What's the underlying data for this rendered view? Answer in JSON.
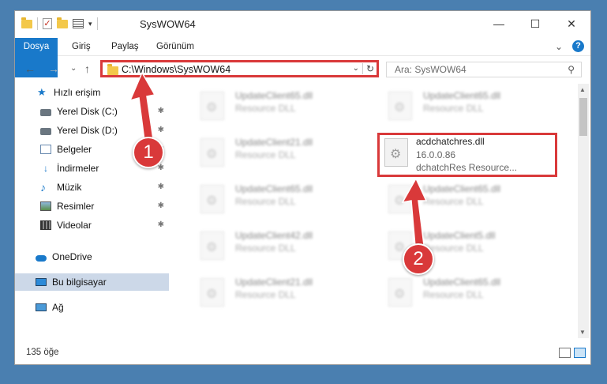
{
  "window": {
    "title": "SysWOW64",
    "controls": {
      "minimize": "—",
      "maximize": "☐",
      "close": "✕"
    }
  },
  "ribbon": {
    "tabs": [
      "Dosya",
      "Giriş",
      "Paylaş",
      "Görünüm"
    ],
    "collapse": "⌄",
    "help": "?"
  },
  "navigation": {
    "back": "←",
    "forward": "→",
    "recent": "⌄",
    "up": "↑",
    "address": "C:\\Windows\\SysWOW64",
    "address_drop": "⌄",
    "refresh": "↻",
    "search_placeholder": "Ara: SysWOW64",
    "search_icon": "⚲"
  },
  "sidebar": {
    "items": [
      {
        "label": "Hızlı erişim",
        "icon": "star-icon",
        "pinned": false
      },
      {
        "label": "Yerel Disk (C:)",
        "icon": "disk-icon",
        "pinned": true
      },
      {
        "label": "Yerel Disk (D:)",
        "icon": "disk-icon",
        "pinned": true
      },
      {
        "label": "Belgeler",
        "icon": "document-icon",
        "pinned": true
      },
      {
        "label": "İndirmeler",
        "icon": "download-icon",
        "pinned": true
      },
      {
        "label": "Müzik",
        "icon": "music-icon",
        "pinned": true
      },
      {
        "label": "Resimler",
        "icon": "pictures-icon",
        "pinned": true
      },
      {
        "label": "Videolar",
        "icon": "videos-icon",
        "pinned": true
      },
      {
        "label": "OneDrive",
        "icon": "cloud-icon",
        "pinned": false
      },
      {
        "label": "Bu bilgisayar",
        "icon": "computer-icon",
        "pinned": false,
        "selected": true
      },
      {
        "label": "Ağ",
        "icon": "network-icon",
        "pinned": false
      }
    ],
    "pin_glyph": "📌"
  },
  "files": {
    "left_column": [
      {
        "name": "UpdateClient65.dll",
        "type": "Resource DLL"
      },
      {
        "name": "UpdateClient21.dll",
        "type": "Resource DLL"
      },
      {
        "name": "UpdateClient65.dll",
        "type": "Resource DLL"
      },
      {
        "name": "UpdateClient42.dll",
        "type": "Resource DLL"
      },
      {
        "name": "UpdateClient21.dll",
        "type": "Resource DLL"
      }
    ],
    "right_column": [
      {
        "name": "UpdateClient65.dll",
        "type": "Resource DLL"
      },
      {
        "name": "UpdateClient65.dll",
        "type": "Resource DLL"
      },
      {
        "name": "UpdateClient5.dll",
        "type": "Resource DLL"
      },
      {
        "name": "UpdateClient65.dll",
        "type": "Resource DLL"
      }
    ],
    "highlighted": {
      "name": "acdchatchres.dll",
      "version": "16.0.0.86",
      "description": "dchatchRes Resource..."
    }
  },
  "status": {
    "item_count": "135 öğe"
  },
  "callouts": [
    "1",
    "2"
  ],
  "colors": {
    "accent": "#1979ca",
    "highlight": "#d9393a",
    "selected": "#ccd8e8"
  }
}
